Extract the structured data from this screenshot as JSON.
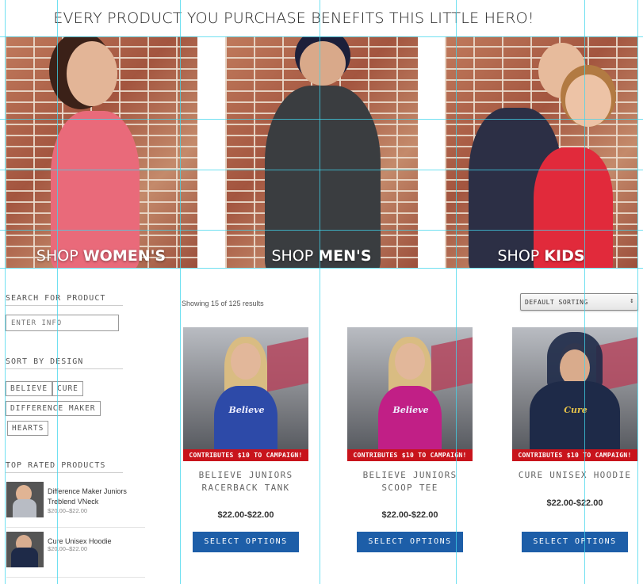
{
  "hero": {
    "title": "EVERY PRODUCT YOU PURCHASE BENEFITS THIS LITTLE HERO!"
  },
  "categories": [
    {
      "prefix": "SHOP",
      "name": "WOMEN'S",
      "shirt_color": "#e96a7a"
    },
    {
      "prefix": "SHOP",
      "name": "MEN'S",
      "shirt_color": "#3a3d40"
    },
    {
      "prefix": "SHOP",
      "name": "KIDS",
      "shirt_color": "#2c2f45"
    }
  ],
  "sidebar": {
    "search_heading": "SEARCH FOR PRODUCT",
    "search_placeholder": "ENTER INFO",
    "design_heading": "SORT BY DESIGN",
    "tags": [
      "BELIEVE",
      "CURE",
      "DIFFERENCE MAKER",
      "HEARTS"
    ],
    "top_rated_heading": "TOP RATED PRODUCTS",
    "top_rated": [
      {
        "name": "Difference Maker Juniors Treblend VNeck",
        "price": "$20.00–$22.00"
      },
      {
        "name": "Cure Unisex Hoodie",
        "price": "$20.00–$22.00"
      }
    ]
  },
  "shop": {
    "results_text": "Showing 15 of 125 results",
    "sort_selected": "DEFAULT SORTING",
    "ribbon_text": "CONTRIBUTES $10 TO CAMPAIGN!",
    "products": [
      {
        "name_line1": "BELIEVE JUNIORS",
        "name_line2": "RACERBACK TANK",
        "price": "$22.00-$22.00",
        "button": "SELECT OPTIONS",
        "shirt_color": "#2d4aa8",
        "print": "Believe"
      },
      {
        "name_line1": "BELIEVE JUNIORS",
        "name_line2": "SCOOP TEE",
        "price": "$22.00-$22.00",
        "button": "SELECT OPTIONS",
        "shirt_color": "#c11f86",
        "print": "Believe"
      },
      {
        "name_line1": "CURE UNISEX HOODIE",
        "name_line2": "",
        "price": "$22.00-$22.00",
        "button": "SELECT OPTIONS",
        "shirt_color": "#1e2a48",
        "print": "Cure"
      }
    ]
  },
  "colors": {
    "button": "#1d5ea8",
    "ribbon": "#c8141c",
    "guide": "#40d6ec"
  }
}
